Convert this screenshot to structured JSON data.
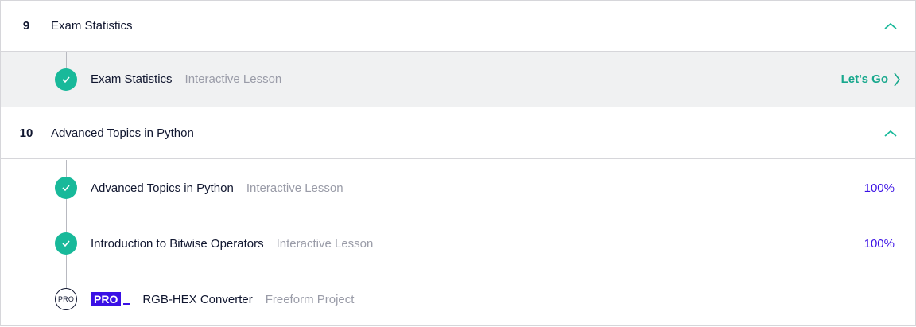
{
  "sections": [
    {
      "number": "9",
      "title": "Exam Statistics",
      "lessons": [
        {
          "title": "Exam Statistics",
          "type": "Interactive Lesson",
          "status": "complete",
          "action": "Let's Go"
        }
      ]
    },
    {
      "number": "10",
      "title": "Advanced Topics in Python",
      "lessons": [
        {
          "title": "Advanced Topics in Python",
          "type": "Interactive Lesson",
          "status": "complete",
          "progress": "100%"
        },
        {
          "title": "Introduction to Bitwise Operators",
          "type": "Interactive Lesson",
          "status": "complete",
          "progress": "100%"
        },
        {
          "title": "RGB-HEX Converter",
          "type": "Freeform Project",
          "status": "pro",
          "badge": "PRO",
          "icon_label": "PRO"
        }
      ]
    }
  ],
  "colors": {
    "accent_green": "#18b99a",
    "pro_purple": "#3a10e5",
    "text": "#10162f",
    "muted": "#9a9ca8"
  },
  "icons": {
    "collapse": "chevron-up-icon",
    "complete": "check-circle-icon",
    "action": "chevron-right-icon"
  }
}
